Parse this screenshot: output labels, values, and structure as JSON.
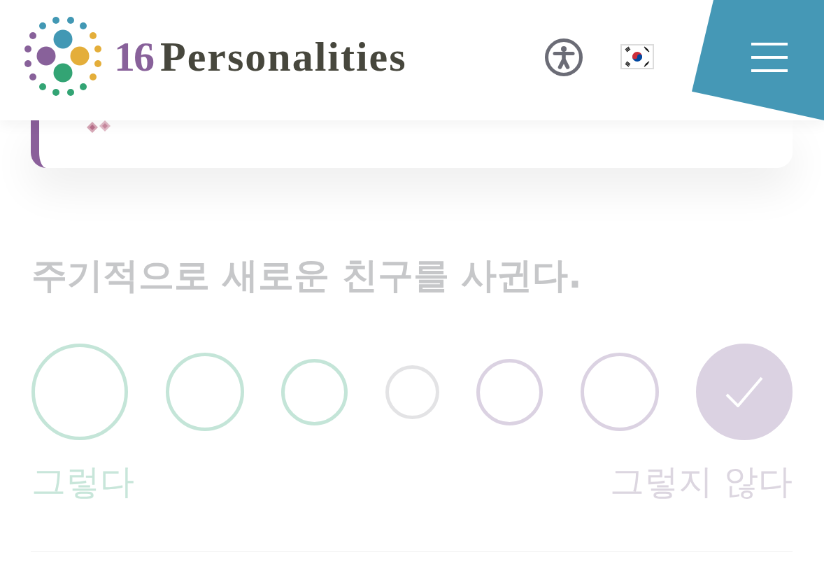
{
  "header": {
    "logo": {
      "number": "16",
      "name": "Personalities"
    }
  },
  "question": {
    "text": "주기적으로 새로운 친구를 사귄다.",
    "answered": true,
    "options": [
      {
        "kind": "agree",
        "selected": false
      },
      {
        "kind": "agree",
        "selected": false
      },
      {
        "kind": "agree",
        "selected": false
      },
      {
        "kind": "neutral",
        "selected": false
      },
      {
        "kind": "disagree",
        "selected": false
      },
      {
        "kind": "disagree",
        "selected": false
      },
      {
        "kind": "disagree",
        "selected": true
      }
    ],
    "scale_labels": [
      {
        "kind": "agree",
        "text": "그렇다"
      },
      {
        "kind": "disagree",
        "text": "그렇지 않다"
      }
    ]
  }
}
